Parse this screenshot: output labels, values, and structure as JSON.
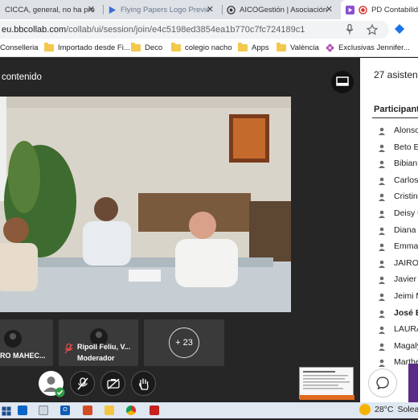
{
  "browser": {
    "tabs": [
      {
        "title": "CICCA, general, no ha pro",
        "active": false
      },
      {
        "title": "Flying Papers Logo Previe",
        "active": false
      },
      {
        "title": "AICOGestión | Asociación",
        "active": false
      },
      {
        "title": "PD Contabilid",
        "active": true
      }
    ],
    "url_host": "eu.bbcollab.com",
    "url_path": "/collab/ui/session/join/e4c5198ed3854ea1b770c7fc724189c1",
    "bookmarks": [
      {
        "label": "Conselleria",
        "icon": "page-icon"
      },
      {
        "label": "Importado desde Fi...",
        "icon": "folder-icon"
      },
      {
        "label": "Deco",
        "icon": "folder-icon"
      },
      {
        "label": "colegio nacho",
        "icon": "folder-icon"
      },
      {
        "label": "Apps",
        "icon": "folder-icon"
      },
      {
        "label": "València",
        "icon": "folder-icon"
      },
      {
        "label": "Exclusivas Jennifer...",
        "icon": "flower-icon"
      }
    ]
  },
  "session": {
    "share_title": "contenido",
    "tiles": [
      {
        "name": "RO MAHEC...",
        "role": ""
      },
      {
        "name": "Ripoll Feliu, V...",
        "role": "Moderador"
      },
      {
        "name": "+ 23",
        "role": ""
      }
    ]
  },
  "panel": {
    "attendee_count": "27 asisten",
    "participants_heading": "Participante",
    "participants": [
      {
        "name": "Alonso",
        "bold": false
      },
      {
        "name": "Beto E",
        "bold": false
      },
      {
        "name": "Bibian",
        "bold": false
      },
      {
        "name": "Carlos",
        "bold": false
      },
      {
        "name": "Cristin",
        "bold": false
      },
      {
        "name": "Deisy C",
        "bold": false
      },
      {
        "name": "Diana",
        "bold": false
      },
      {
        "name": "Emma",
        "bold": false
      },
      {
        "name": "JAIRO",
        "bold": false
      },
      {
        "name": "Javier",
        "bold": false
      },
      {
        "name": "Jeimi M",
        "bold": false
      },
      {
        "name": "José B",
        "bold": true
      },
      {
        "name": "LAURA",
        "bold": false
      },
      {
        "name": "Magaly",
        "bold": false
      },
      {
        "name": "Marthe",
        "bold": false
      }
    ]
  },
  "taskbar": {
    "temperature": "28°C",
    "weather_text": "Solea"
  },
  "colors": {
    "stage_bg": "#262626",
    "panel_accent": "#5b2a86",
    "tile_bg": "#3a3a3a"
  }
}
